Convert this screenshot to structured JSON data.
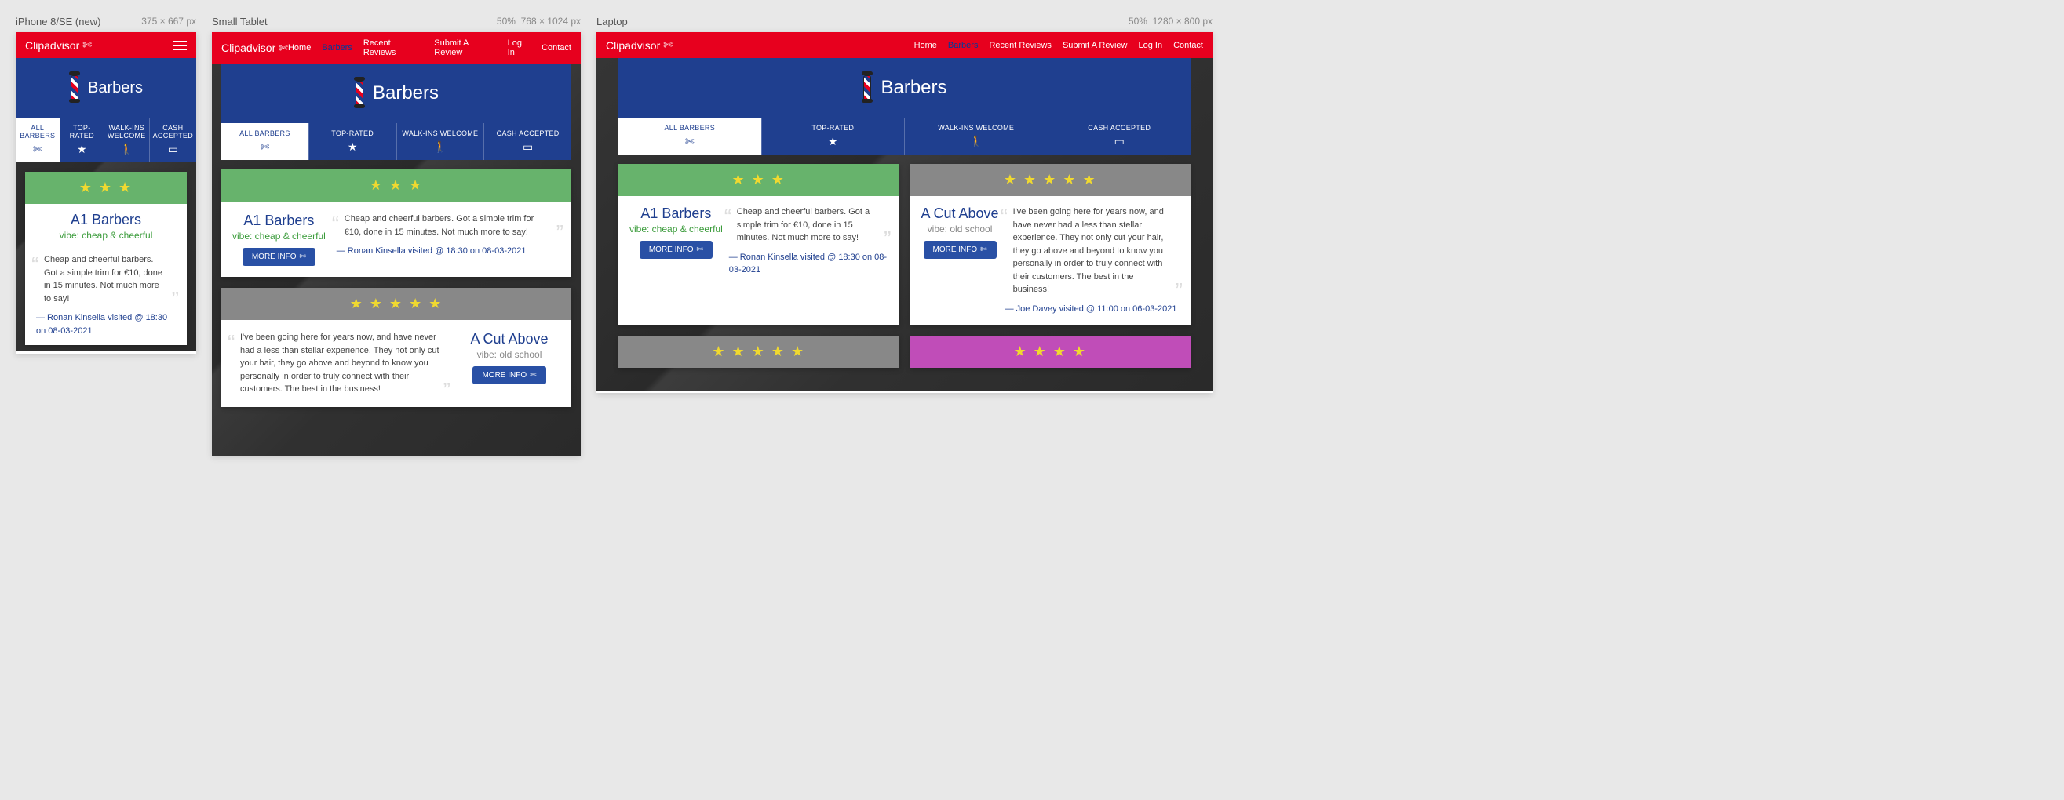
{
  "viewports": {
    "v1": {
      "label": "iPhone 8/SE (new)",
      "dims": "375 × 667 px"
    },
    "v2": {
      "label": "Small Tablet",
      "scale": "50%",
      "dims": "768 × 1024 px"
    },
    "v3": {
      "label": "Laptop",
      "scale": "50%",
      "dims": "1280 × 800 px"
    }
  },
  "brand": "Clipadvisor",
  "nav": {
    "home": "Home",
    "barbers": "Barbers",
    "recent": "Recent Reviews",
    "submit": "Submit A Review",
    "login": "Log In",
    "contact": "Contact"
  },
  "hero": {
    "title": "Barbers"
  },
  "tabs": {
    "all": "ALL BARBERS",
    "top": "TOP-RATED",
    "walk": "WALK-INS WELCOME",
    "cash": "CASH ACCEPTED"
  },
  "cards": {
    "a1": {
      "name": "A1 Barbers",
      "vibe": "vibe: cheap & cheerful",
      "more": "MORE INFO",
      "review_short": "Cheap and cheerful barbers. Got a simple trim for €10, done in 15 minutes. Not much more to say!",
      "visited": "—  Ronan Kinsella visited @ 18:30 on 08-03-2021",
      "stars": "★ ★ ★"
    },
    "cut": {
      "name": "A Cut Above",
      "vibe": "vibe: old school",
      "more": "MORE INFO",
      "review": "I've been going here for years now, and have never had a less than stellar experience. They not only cut your hair, they go above and beyond to know you personally in order to truly connect with their customers. The best in the business!",
      "visited": "—  Joe Davey visited @ 11:00 on 06-03-2021",
      "stars": "★ ★ ★ ★ ★"
    },
    "extra": {
      "stars5": "★ ★ ★ ★ ★",
      "stars4": "★ ★ ★ ★"
    }
  }
}
